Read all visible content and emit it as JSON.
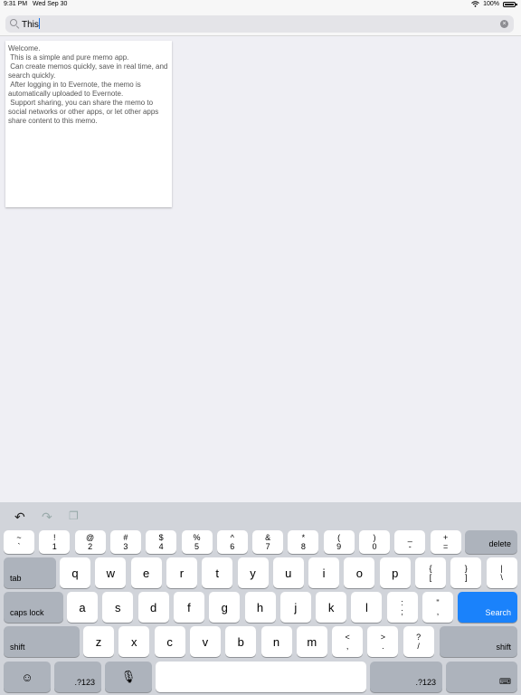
{
  "status": {
    "time": "9:31 PM",
    "date": "Wed Sep 30",
    "battery": "100%",
    "wifi_icon": "wifi-icon"
  },
  "search": {
    "value": "This",
    "clear_icon": "×"
  },
  "memo": {
    "text": "Welcome.\n This is a simple and pure memo app.\n Can create memos quickly, save in real time, and search quickly.\n After logging in to Evernote, the memo is automatically uploaded to Evernote.\n Support sharing, you can share the memo to social networks or other apps, or let other apps share content to this memo."
  },
  "toolbar": {
    "undo": "↶",
    "redo": "↷",
    "paste": "❐"
  },
  "keys": {
    "row1": [
      {
        "top": "~",
        "bottom": "`"
      },
      {
        "top": "!",
        "bottom": "1"
      },
      {
        "top": "@",
        "bottom": "2"
      },
      {
        "top": "#",
        "bottom": "3"
      },
      {
        "top": "$",
        "bottom": "4"
      },
      {
        "top": "%",
        "bottom": "5"
      },
      {
        "top": "^",
        "bottom": "6"
      },
      {
        "top": "&",
        "bottom": "7"
      },
      {
        "top": "*",
        "bottom": "8"
      },
      {
        "top": "(",
        "bottom": "9"
      },
      {
        "top": ")",
        "bottom": "0"
      },
      {
        "top": "_",
        "bottom": "-"
      },
      {
        "top": "+",
        "bottom": "="
      }
    ],
    "delete": "delete",
    "tab": "tab",
    "row2": [
      "q",
      "w",
      "e",
      "r",
      "t",
      "y",
      "u",
      "i",
      "o",
      "p"
    ],
    "row2_sym": [
      {
        "top": "{",
        "bottom": "["
      },
      {
        "top": "}",
        "bottom": "]"
      },
      {
        "top": "|",
        "bottom": "\\"
      }
    ],
    "caps_lock": "caps lock",
    "row3": [
      "a",
      "s",
      "d",
      "f",
      "g",
      "h",
      "j",
      "k",
      "l"
    ],
    "row3_sym": [
      {
        "top": ":",
        "bottom": ";"
      },
      {
        "top": "\"",
        "bottom": ","
      }
    ],
    "search": "Search",
    "shift": "shift",
    "row4": [
      "z",
      "x",
      "c",
      "v",
      "b",
      "n",
      "m"
    ],
    "row4_sym": [
      {
        "top": "<",
        "bottom": ","
      },
      {
        "top": ">",
        "bottom": "."
      },
      {
        "top": "?",
        "bottom": "/"
      }
    ],
    "emoji": "☺",
    "numbers": ".?123",
    "mic": "🎙",
    "space": "",
    "hide_keyboard": "⌨"
  },
  "colors": {
    "search_key": "#1a82fb",
    "background": "#efeff4",
    "keyboard": "#d1d4da"
  }
}
